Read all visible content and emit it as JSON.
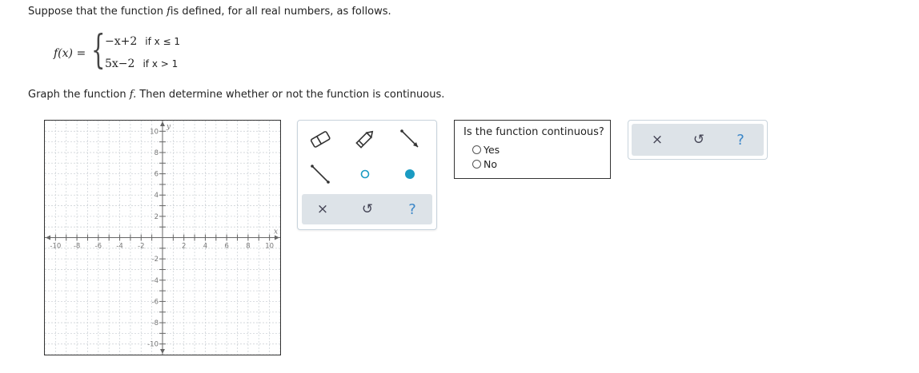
{
  "question": {
    "intro_pre": "Suppose that the function ",
    "func_name": "f",
    "intro_post": "is defined, for all real numbers, as follows.",
    "fx_label": "f(x) =",
    "pieces": [
      {
        "expr": "−x+2",
        "condition": "if x ≤ 1"
      },
      {
        "expr": "5x−2",
        "condition": "if x > 1"
      }
    ],
    "instruction_pre": "Graph the function ",
    "instruction_func": "f.",
    "instruction_post": " Then determine whether or not the function is continuous."
  },
  "graph": {
    "x_axis_label": "x",
    "y_axis_label": "y",
    "range": [
      -11,
      11
    ],
    "x_tick_labels": [
      "-10",
      "-8",
      "-6",
      "-4",
      "-2",
      "2",
      "4",
      "6",
      "8",
      "10"
    ],
    "y_tick_labels": [
      "10",
      "8",
      "6",
      "4",
      "2",
      "-2",
      "-4",
      "-6",
      "-8",
      "-10"
    ]
  },
  "toolbox": {
    "tools": [
      "eraser-icon",
      "pencil-icon",
      "ray-icon",
      "segment-icon",
      "open-circle-icon",
      "closed-circle-icon"
    ],
    "actions": {
      "clear": "×",
      "undo": "↺",
      "help": "?"
    }
  },
  "continuity_question": {
    "title": "Is the function continuous?",
    "options": [
      "Yes",
      "No"
    ]
  },
  "answer_actions": {
    "clear": "×",
    "undo": "↺",
    "help": "?"
  },
  "colors": {
    "accent": "#1a9bc2",
    "tool_bar": "#dde3e8",
    "grid": "#cfd4d8"
  }
}
